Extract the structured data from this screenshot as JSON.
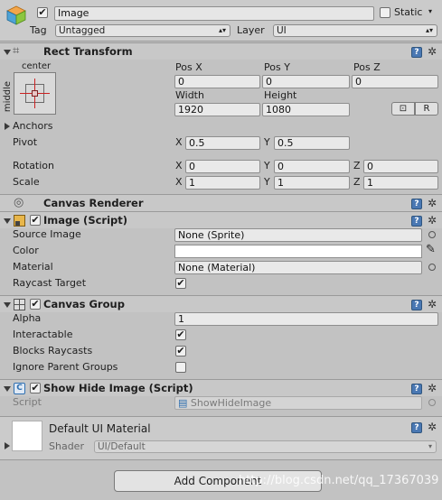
{
  "header": {
    "object_name": "Image",
    "static_label": "Static",
    "tag_label": "Tag",
    "tag_value": "Untagged",
    "layer_label": "Layer",
    "layer_value": "UI"
  },
  "rect_transform": {
    "title": "Rect Transform",
    "anchor_h": "center",
    "anchor_v": "middle",
    "pos_x_label": "Pos X",
    "pos_y_label": "Pos Y",
    "pos_z_label": "Pos Z",
    "pos_x": "0",
    "pos_y": "0",
    "pos_z": "0",
    "width_label": "Width",
    "height_label": "Height",
    "width": "1920",
    "height": "1080",
    "blueprint_btn": "⊡",
    "raw_btn": "R",
    "anchors_label": "Anchors",
    "pivot_label": "Pivot",
    "pivot_x": "0.5",
    "pivot_y": "0.5",
    "rotation_label": "Rotation",
    "rot_x": "0",
    "rot_y": "0",
    "rot_z": "0",
    "scale_label": "Scale",
    "scale_x": "1",
    "scale_y": "1",
    "scale_z": "1",
    "x": "X",
    "y": "Y",
    "z": "Z"
  },
  "canvas_renderer": {
    "title": "Canvas Renderer"
  },
  "image_script": {
    "title": "Image (Script)",
    "source_image_label": "Source Image",
    "source_image_value": "None (Sprite)",
    "color_label": "Color",
    "material_label": "Material",
    "material_value": "None (Material)",
    "raycast_label": "Raycast Target"
  },
  "canvas_group": {
    "title": "Canvas Group",
    "alpha_label": "Alpha",
    "alpha_value": "1",
    "interactable_label": "Interactable",
    "blocks_raycasts_label": "Blocks Raycasts",
    "ignore_parent_label": "Ignore Parent Groups"
  },
  "show_hide": {
    "title": "Show Hide Image (Script)",
    "script_label": "Script",
    "script_value": "ShowHideImage"
  },
  "material": {
    "title": "Default UI Material",
    "shader_label": "Shader",
    "shader_value": "UI/Default"
  },
  "footer": {
    "add_component": "Add Component",
    "watermark": "http://blog.csdn.net/qq_17367039"
  },
  "checkmark": "✔",
  "colors": {
    "header_bg": "#c8c8c8",
    "panel_bg": "#c2c2c2",
    "field_bg": "#e9e9e9",
    "help_blue": "#4a78b3"
  }
}
